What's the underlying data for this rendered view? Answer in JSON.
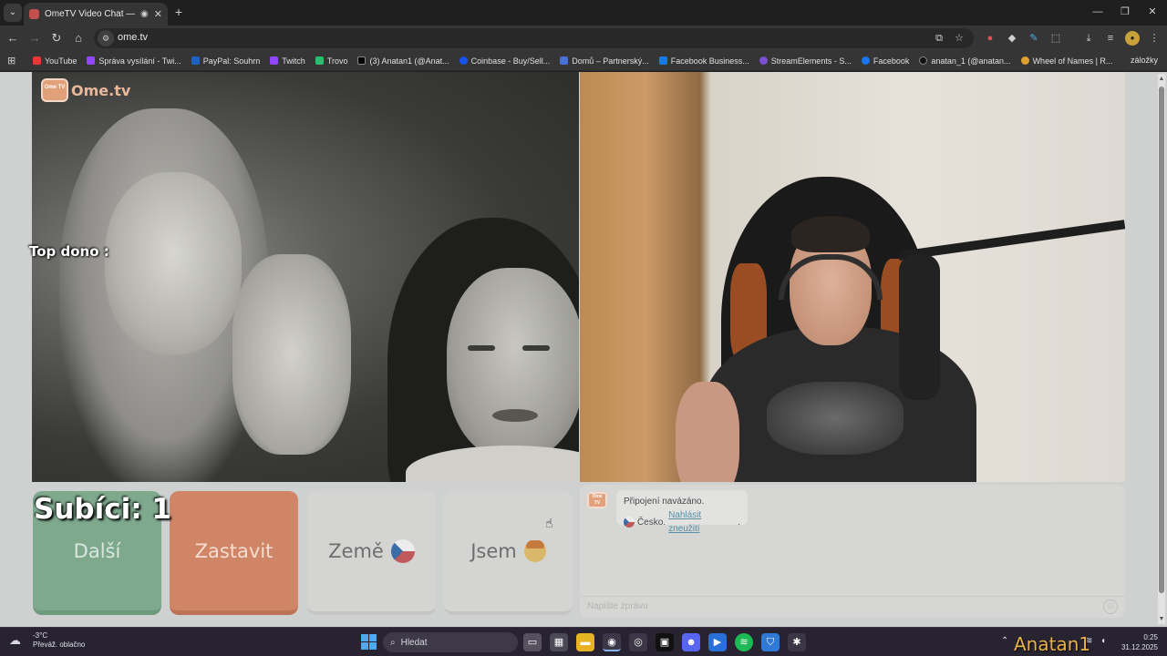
{
  "browser": {
    "tab_title": "OmeTV Video Chat — Ome",
    "url": "ome.tv",
    "bookmarks": [
      {
        "label": "YouTube",
        "color": "#e53935"
      },
      {
        "label": "Správa vysílání - Twi...",
        "color": "#9146ff"
      },
      {
        "label": "PayPal: Souhrn",
        "color": "#1e63c4"
      },
      {
        "label": "Twitch",
        "color": "#9146ff"
      },
      {
        "label": "Trovo",
        "color": "#26c16f"
      },
      {
        "label": "(3) Anatan1 (@Anat...",
        "color": "#000000"
      },
      {
        "label": "Coinbase - Buy/Sell...",
        "color": "#1652f0"
      },
      {
        "label": "Domů – Partnerský...",
        "color": "#4a6fd6"
      },
      {
        "label": "Facebook Business...",
        "color": "#1877f2"
      },
      {
        "label": "StreamElements - S...",
        "color": "#7b4fd6"
      },
      {
        "label": "Facebook",
        "color": "#1877f2"
      },
      {
        "label": "anatan_1 (@anatan...",
        "color": "#111111"
      },
      {
        "label": "Wheel of Names | R...",
        "color": "#e0a030"
      }
    ],
    "bookmarks_end": "záložky"
  },
  "page": {
    "logo_text": "Ome.tv",
    "logo_tv": "Ome TV",
    "overlay_top_dono": "Top dono :",
    "buttons": {
      "next": "Další",
      "stop": "Zastavit",
      "country": "Země",
      "gender": "Jsem"
    },
    "overlay_subs": "Subíci: 1",
    "chat": {
      "status": "Připojení navázáno.",
      "country": "Česko.",
      "report_link": "Nahlásit zneužití",
      "report_suffix": ".",
      "input_placeholder": "Napište zprávu"
    }
  },
  "taskbar": {
    "weather_temp": "-3°C",
    "weather_desc": "Převáž. oblačno",
    "search_label": "Hledat",
    "time": "0:25",
    "date": "31.12.2025",
    "watermark": "Anatan1"
  },
  "colors": {
    "next_button": "#7ea98d",
    "stop_button": "#cf8566",
    "neutral_button": "#d4d4d3",
    "report_link": "#5c8fa6"
  }
}
